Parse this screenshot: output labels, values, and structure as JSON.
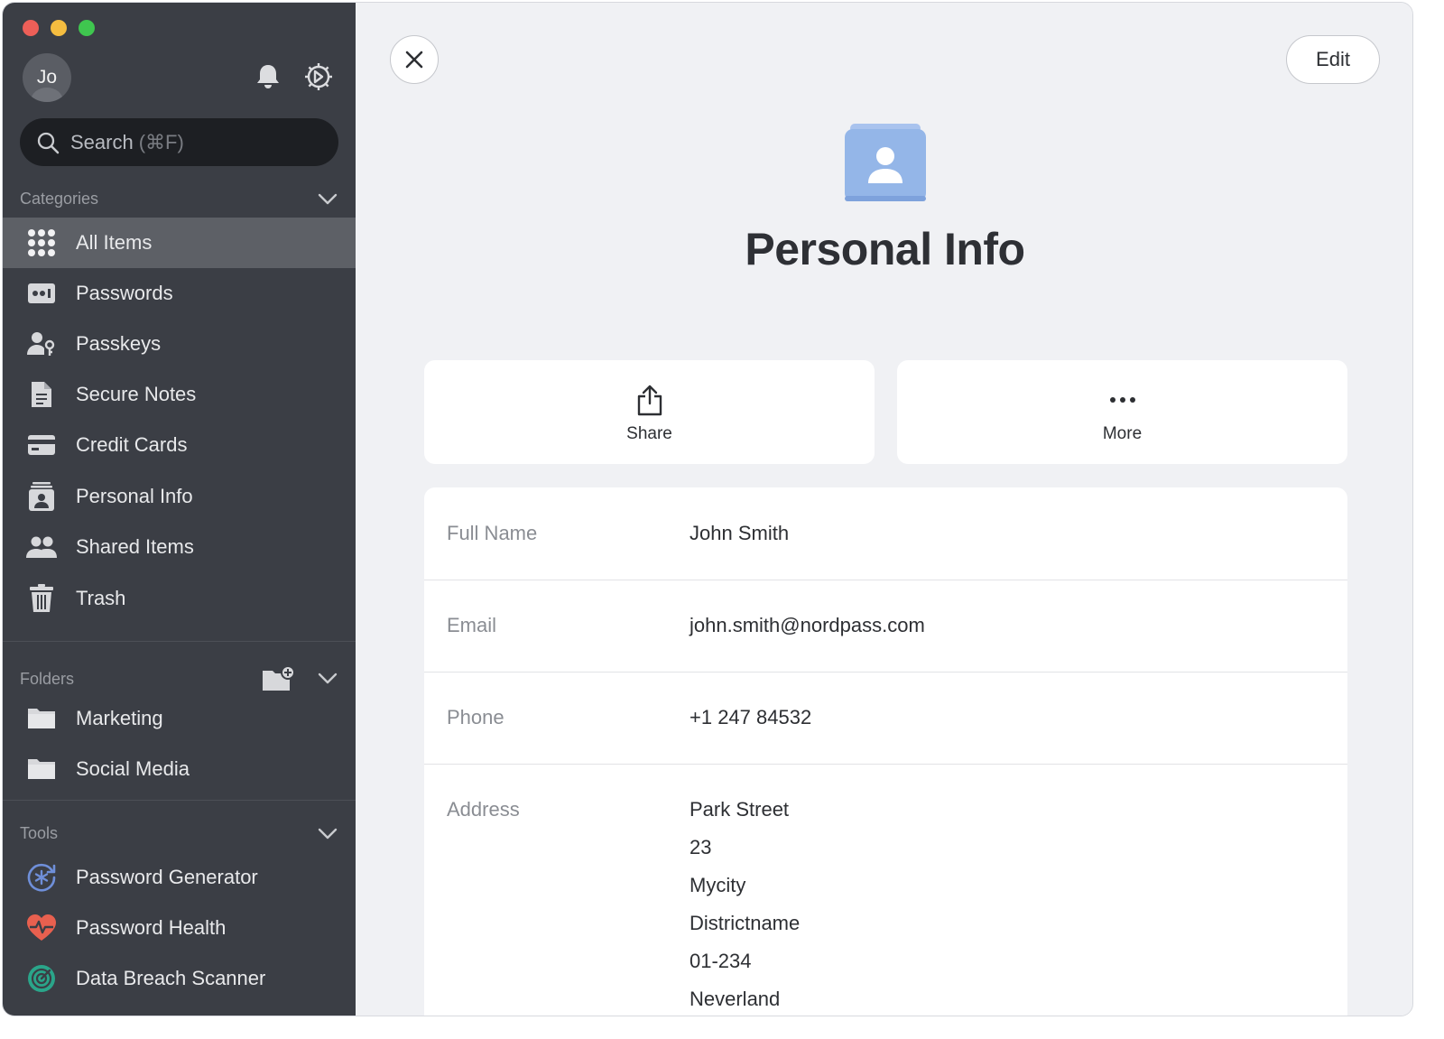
{
  "sidebar": {
    "avatar_initials": "Jo",
    "search": {
      "placeholder": "Search",
      "shortcut": "(⌘F)"
    },
    "categories_label": "Categories",
    "categories": [
      {
        "label": "All Items",
        "icon": "grid-icon",
        "active": true
      },
      {
        "label": "Passwords",
        "icon": "password-icon"
      },
      {
        "label": "Passkeys",
        "icon": "passkey-icon"
      },
      {
        "label": "Secure Notes",
        "icon": "note-icon"
      },
      {
        "label": "Credit Cards",
        "icon": "credit-card-icon"
      },
      {
        "label": "Personal Info",
        "icon": "personal-info-icon"
      },
      {
        "label": "Shared Items",
        "icon": "shared-users-icon"
      },
      {
        "label": "Trash",
        "icon": "trash-icon"
      }
    ],
    "folders_label": "Folders",
    "folders": [
      {
        "label": "Marketing",
        "icon": "folder-icon"
      },
      {
        "label": "Social Media",
        "icon": "folder-icon"
      }
    ],
    "tools_label": "Tools",
    "tools": [
      {
        "label": "Password Generator",
        "icon": "generator-icon"
      },
      {
        "label": "Password Health",
        "icon": "health-icon"
      },
      {
        "label": "Data Breach Scanner",
        "icon": "scanner-icon"
      }
    ]
  },
  "main": {
    "edit_label": "Edit",
    "title": "Personal Info",
    "actions": {
      "share": "Share",
      "more": "More"
    },
    "fields": {
      "full_name": {
        "label": "Full Name",
        "value": "John Smith"
      },
      "email": {
        "label": "Email",
        "value": "john.smith@nordpass.com"
      },
      "phone": {
        "label": "Phone",
        "value": "+1 247 84532"
      },
      "address": {
        "label": "Address",
        "lines": [
          "Park Street",
          "23",
          "Mycity",
          "Districtname",
          "01-234",
          "Neverland"
        ]
      }
    }
  },
  "colors": {
    "sidebar_bg": "#3b3e45",
    "active_item_bg": "#5d6066",
    "main_bg": "#f0f1f4",
    "item_icon_blue": "#94b6e8"
  }
}
